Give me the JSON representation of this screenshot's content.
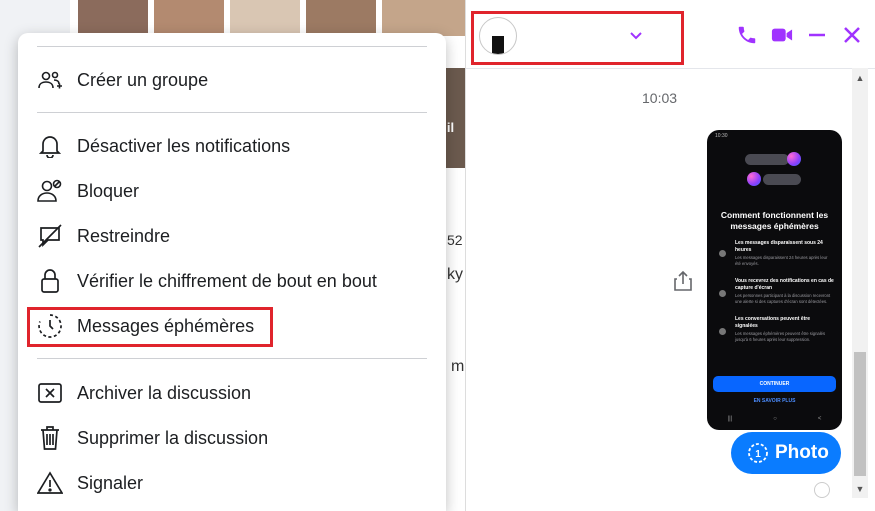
{
  "background": {
    "partial_text_1": "elil",
    "partial_text_2": "52",
    "partial_text_3": "ky",
    "partial_text_4": "m"
  },
  "menu": {
    "items": [
      {
        "label": "Créer un groupe",
        "icon": "create-group-icon"
      },
      {
        "label": "Désactiver les notifications",
        "icon": "bell-icon"
      },
      {
        "label": "Bloquer",
        "icon": "block-user-icon"
      },
      {
        "label": "Restreindre",
        "icon": "restrict-icon"
      },
      {
        "label": "Vérifier le chiffrement de bout en bout",
        "icon": "lock-icon"
      },
      {
        "label": "Messages éphémères",
        "icon": "disappearing-messages-icon"
      },
      {
        "label": "Archiver la discussion",
        "icon": "archive-icon"
      },
      {
        "label": "Supprimer la discussion",
        "icon": "trash-icon"
      },
      {
        "label": "Signaler",
        "icon": "warning-icon"
      }
    ],
    "highlighted_item": "Messages éphémères"
  },
  "chat": {
    "timestamp": "10:03",
    "accent_color": "#a033ff",
    "bubble_color": "#0a7cff",
    "photo_bubble_label": "Photo",
    "photo_view_once_label": "1",
    "screenshot": {
      "status_time": "10:30",
      "title": "Comment fonctionnent les messages éphémères",
      "blocks": [
        {
          "heading": "Les messages disparaissent sous 24 heures",
          "sub": "Les messages disparaissent 24 heures après leur été envoyés."
        },
        {
          "heading": "Vous recevrez des notifications en cas de capture d'écran",
          "sub": "Les personnes participant à la discussion recevront une alerte si des captures d'écran sont détectées."
        },
        {
          "heading": "Les conversations peuvent être signalées",
          "sub": "Les messages éphémères peuvent être signalés jusqu'à 6 heures après leur suppression."
        }
      ],
      "button_label": "CONTINUER",
      "link_label": "EN SAVOIR PLUS",
      "nav": [
        "|||",
        "○",
        "<"
      ]
    }
  },
  "colors": {
    "highlight_red": "#e0242c",
    "menu_bg": "#ffffff"
  }
}
